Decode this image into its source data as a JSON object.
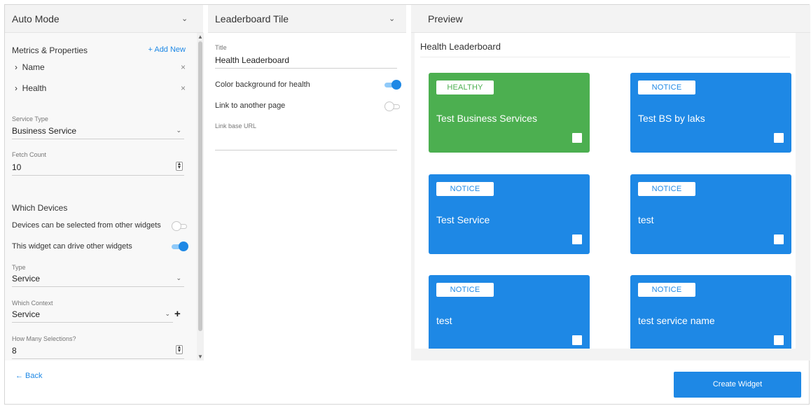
{
  "header": {
    "left_title": "Auto Mode",
    "middle_title": "Leaderboard Tile",
    "right_title": "Preview"
  },
  "left": {
    "metrics_title": "Metrics & Properties",
    "add_new": "+ Add New",
    "metrics": [
      {
        "label": "Name"
      },
      {
        "label": "Health"
      }
    ],
    "service_type": {
      "label": "Service Type",
      "value": "Business Service"
    },
    "fetch_count": {
      "label": "Fetch Count",
      "value": "10"
    },
    "which_devices_title": "Which Devices",
    "devices_selectable": {
      "label": "Devices can be selected from other widgets",
      "on": false
    },
    "drive_widgets": {
      "label": "This widget can drive other widgets",
      "on": true
    },
    "type": {
      "label": "Type",
      "value": "Service"
    },
    "which_context": {
      "label": "Which Context",
      "value": "Service"
    },
    "how_many": {
      "label": "How Many Selections?",
      "value": "8"
    }
  },
  "middle": {
    "title_field": {
      "label": "Title",
      "value": "Health Leaderboard"
    },
    "color_bg": {
      "label": "Color background for health",
      "on": true
    },
    "link_page": {
      "label": "Link to another page",
      "on": false
    },
    "link_base_url": {
      "label": "Link base URL",
      "value": ""
    }
  },
  "preview": {
    "title": "Health Leaderboard",
    "tiles": [
      {
        "badge": "HEALTHY",
        "name": "Test Business Services",
        "status": "healthy"
      },
      {
        "badge": "NOTICE",
        "name": "Test BS by laks",
        "status": "notice"
      },
      {
        "badge": "NOTICE",
        "name": "Test Service",
        "status": "notice"
      },
      {
        "badge": "NOTICE",
        "name": "test",
        "status": "notice"
      },
      {
        "badge": "NOTICE",
        "name": "test",
        "status": "notice"
      },
      {
        "badge": "NOTICE",
        "name": "test service name",
        "status": "notice"
      }
    ]
  },
  "footer": {
    "back": "← Back",
    "create": "Create Widget"
  },
  "colors": {
    "accent": "#1e88e5",
    "healthy": "#4caf50",
    "notice": "#1e88e5"
  }
}
